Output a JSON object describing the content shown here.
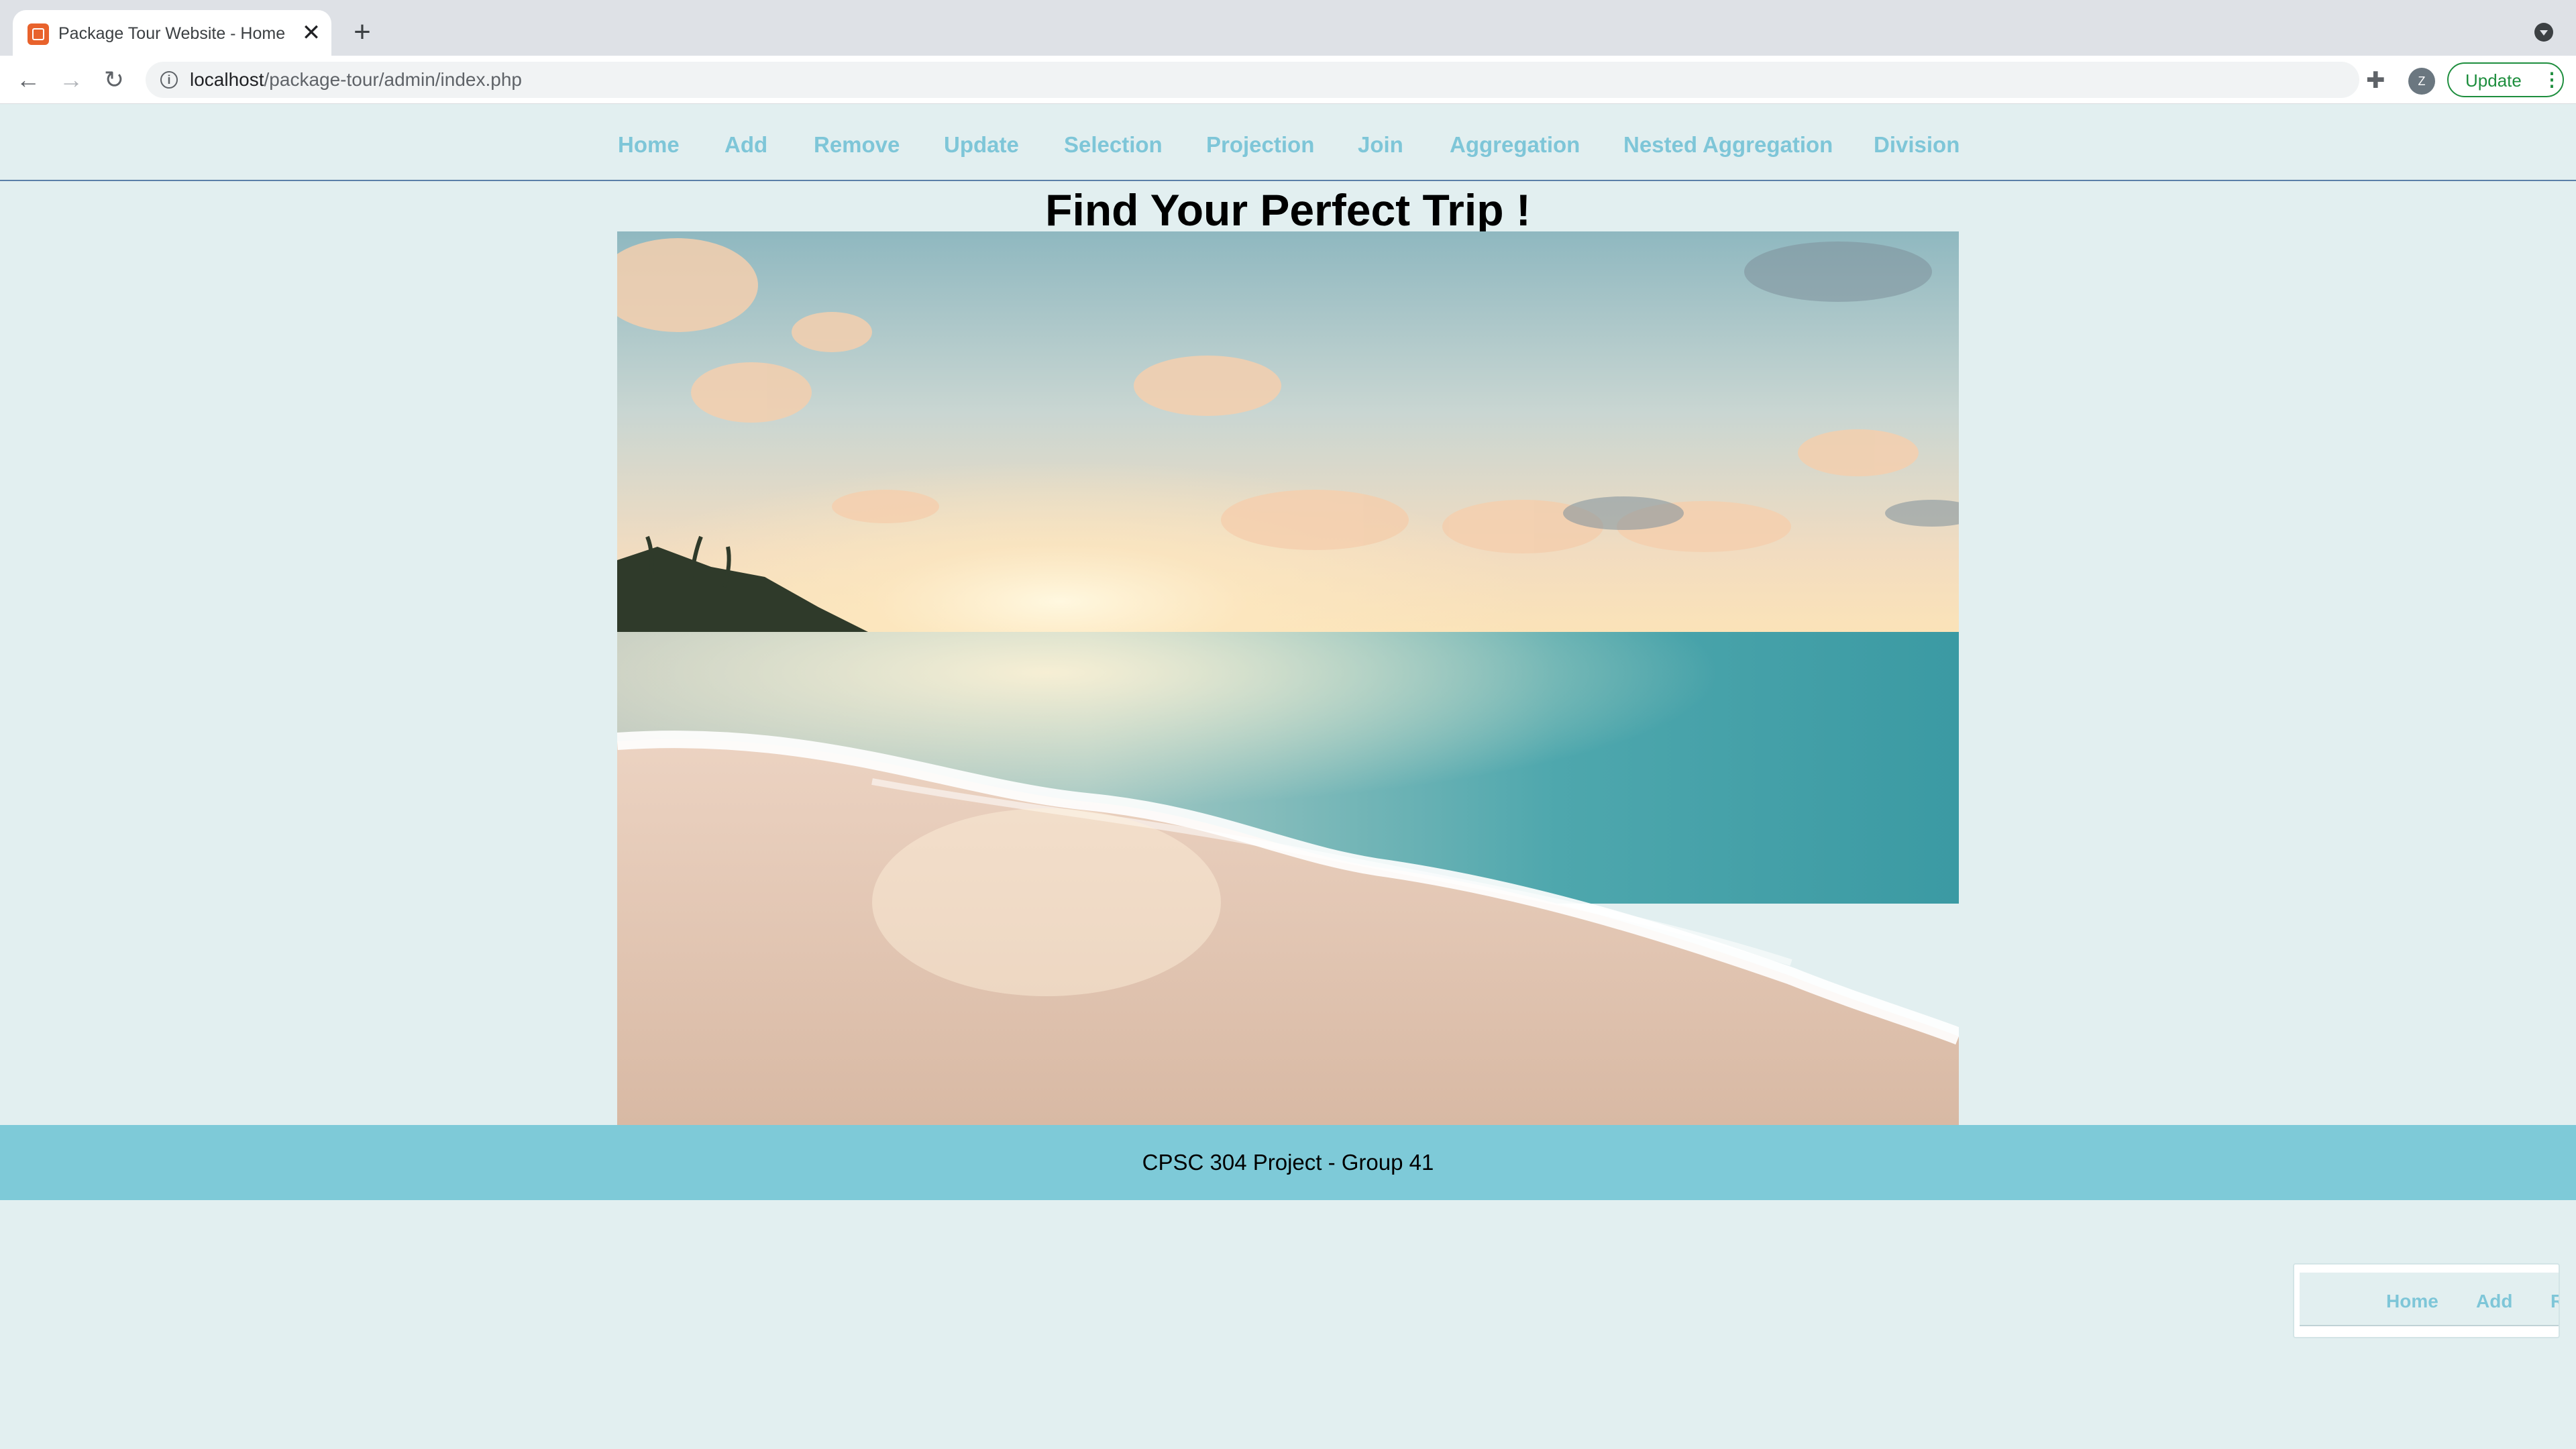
{
  "browser": {
    "tab_title": "Package Tour Website - Home",
    "tab_close": "✕",
    "new_tab": "+",
    "back": "←",
    "forward": "→",
    "reload": "↻",
    "url_host": "localhost",
    "url_path": "/package-tour/admin/index.php",
    "info": "i",
    "star": "☆",
    "extensions": "✚",
    "profile_initial": "Z",
    "update_label": "Update",
    "update_menu": "⋮",
    "icons": [
      "tab-favicon",
      "close-icon",
      "plus-icon",
      "back-arrow-icon",
      "forward-arrow-icon",
      "reload-icon",
      "info-icon",
      "star-icon",
      "puzzle-icon",
      "avatar",
      "kebab-menu-icon",
      "tab-search-icon"
    ]
  },
  "site": {
    "nav": [
      "Home",
      "Add",
      "Remove",
      "Update",
      "Selection",
      "Projection",
      "Join",
      "Aggregation",
      "Nested Aggregation",
      "Division"
    ],
    "headline": "Find Your Perfect Trip !",
    "footer": "CPSC 304 Project - Group 41",
    "mini_nav": [
      "Home",
      "Add",
      "R"
    ],
    "colors": {
      "page_bg": "#e2eff0",
      "nav_link": "#7ec6d8",
      "footer_bg": "#7ecad8",
      "nav_rule": "#5b7fa8"
    }
  }
}
